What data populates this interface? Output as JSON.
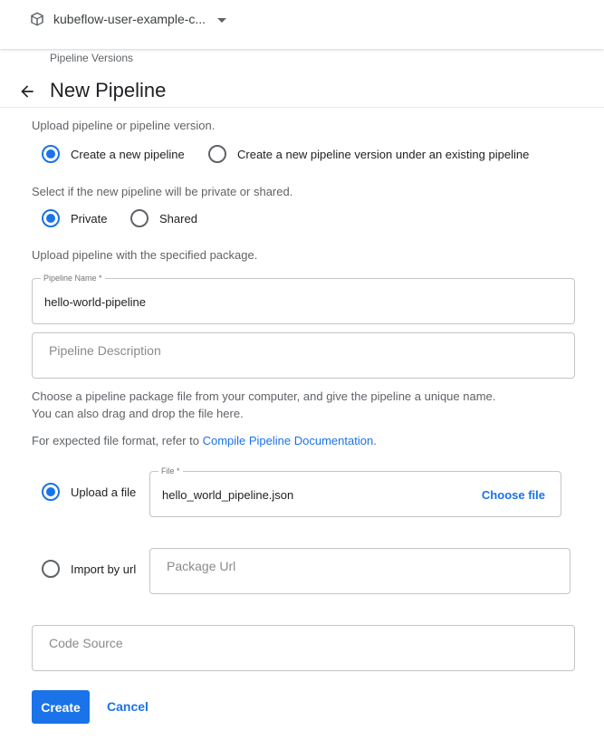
{
  "topbar": {
    "namespace": "kubeflow-user-example-c...",
    "namespace_icon": "cube-icon",
    "dropdown_icon": "caret-down-icon"
  },
  "breadcrumb": "Pipeline Versions",
  "header": {
    "back_icon": "arrow-left-icon",
    "title": "New Pipeline"
  },
  "form": {
    "upload_prompt": "Upload pipeline or pipeline version.",
    "upload_mode_options": [
      {
        "label": "Create a new pipeline",
        "selected": true
      },
      {
        "label": "Create a new pipeline version under an existing pipeline",
        "selected": false
      }
    ],
    "visibility_prompt": "Select if the new pipeline will be private or shared.",
    "visibility_options": [
      {
        "label": "Private",
        "selected": true
      },
      {
        "label": "Shared",
        "selected": false
      }
    ],
    "package_prompt": "Upload pipeline with the specified package.",
    "pipeline_name": {
      "label": "Pipeline Name *",
      "value": "hello-world-pipeline"
    },
    "pipeline_description": {
      "placeholder": "Pipeline Description",
      "value": ""
    },
    "help_line1": "Choose a pipeline package file from your computer, and give the pipeline a unique name.",
    "help_line2": "You can also drag and drop the file here.",
    "format_prefix": "For expected file format, refer to ",
    "format_link": "Compile Pipeline Documentation",
    "format_suffix": ".",
    "source_options": [
      {
        "label": "Upload a file",
        "selected": true
      },
      {
        "label": "Import by url",
        "selected": false
      }
    ],
    "file": {
      "label": "File *",
      "value": "hello_world_pipeline.json",
      "choose_label": "Choose file"
    },
    "package_url": {
      "placeholder": "Package Url",
      "value": ""
    },
    "code_source": {
      "placeholder": "Code Source",
      "value": ""
    }
  },
  "actions": {
    "create_label": "Create",
    "cancel_label": "Cancel"
  },
  "colors": {
    "accent": "#1a73e8",
    "text_secondary": "#5f6368"
  }
}
